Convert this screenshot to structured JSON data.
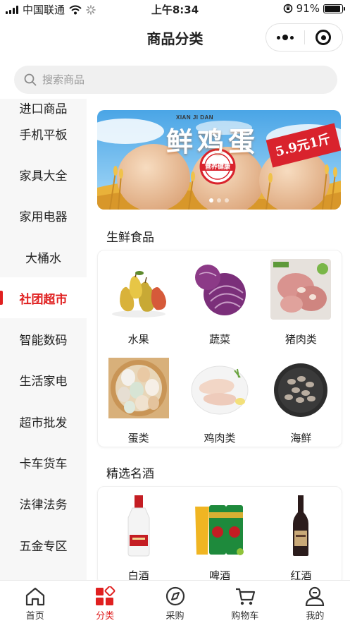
{
  "status_bar": {
    "carrier": "中国联通",
    "time": "上午8:34",
    "battery_percent": "91%",
    "battery_level": 0.91
  },
  "nav": {
    "title": "商品分类"
  },
  "search": {
    "placeholder": "搜索商品"
  },
  "sidebar": {
    "active_index": 5,
    "items": [
      {
        "label": "进口商品"
      },
      {
        "label": "手机平板"
      },
      {
        "label": "家具大全"
      },
      {
        "label": "家用电器"
      },
      {
        "label": "大桶水"
      },
      {
        "label": "社团超市"
      },
      {
        "label": "智能数码"
      },
      {
        "label": "生活家电"
      },
      {
        "label": "超市批发"
      },
      {
        "label": "卡车货车"
      },
      {
        "label": "法律法务"
      },
      {
        "label": "五金专区"
      }
    ]
  },
  "banner": {
    "brand": "XIAN JI DAN",
    "headline": "鲜鸡蛋",
    "price_tag": "5.9元1斤",
    "stamp": "营养健康",
    "page_count": 3,
    "current_page": 1
  },
  "sections": [
    {
      "title": "生鲜食品",
      "items": [
        {
          "label": "水果",
          "icon": "pears-image"
        },
        {
          "label": "蔬菜",
          "icon": "cabbage-image"
        },
        {
          "label": "猪肉类",
          "icon": "pork-image"
        },
        {
          "label": "蛋类",
          "icon": "eggs-image"
        },
        {
          "label": "鸡肉类",
          "icon": "chicken-wings-image"
        },
        {
          "label": "海鲜",
          "icon": "clams-image"
        }
      ]
    },
    {
      "title": "精选名酒",
      "items": [
        {
          "label": "白酒",
          "icon": "baijiu-bottle-image"
        },
        {
          "label": "啤酒",
          "icon": "beer-cans-image"
        },
        {
          "label": "红酒",
          "icon": "red-wine-bottle-image"
        }
      ]
    }
  ],
  "tabs": [
    {
      "label": "首页",
      "icon": "home-icon"
    },
    {
      "label": "分类",
      "icon": "category-icon"
    },
    {
      "label": "采购",
      "icon": "compass-icon"
    },
    {
      "label": "购物车",
      "icon": "cart-icon"
    },
    {
      "label": "我的",
      "icon": "user-icon"
    }
  ],
  "active_tab": 1,
  "colors": {
    "accent": "#e02020",
    "sidebar_bg": "#f7f7f7",
    "search_bg": "#f0f0f0"
  }
}
